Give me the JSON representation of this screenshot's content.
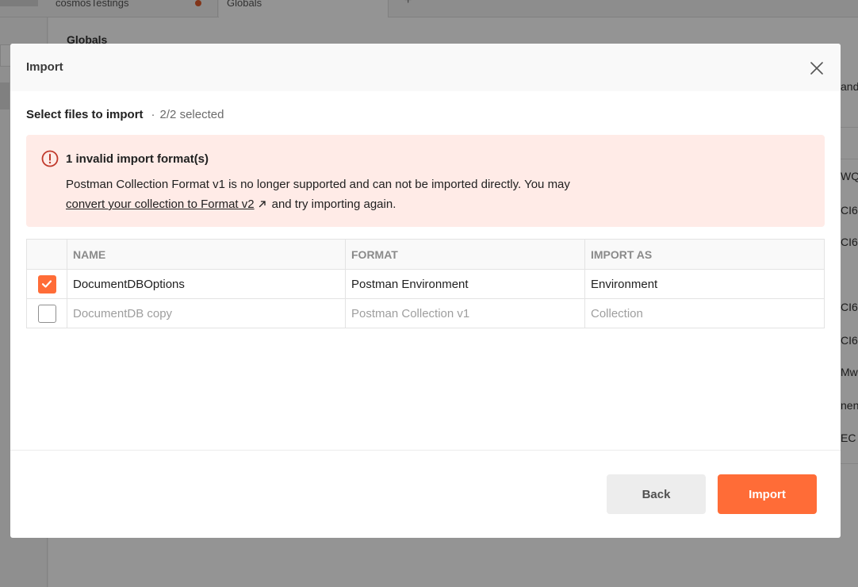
{
  "background": {
    "tabs": [
      {
        "label": "cosmosTestings"
      },
      {
        "label": "Globals"
      }
    ],
    "page_title": "Globals",
    "right_cells": [
      "and c",
      "WQ",
      "CI6",
      "CI6",
      "CI6",
      "CI6",
      "MwY",
      "nent",
      "EC"
    ]
  },
  "modal": {
    "title": "Import",
    "select_label": "Select files to import",
    "separator": "·",
    "selected_count": "2/2 selected",
    "alert": {
      "title": "1 invalid import format(s)",
      "message": "Postman Collection Format v1 is no longer supported and can not be imported directly. You may",
      "link_text": "convert your collection to Format v2",
      "message_end": "and try importing again."
    },
    "table": {
      "headers": [
        "NAME",
        "FORMAT",
        "IMPORT AS"
      ],
      "rows": [
        {
          "name": "DocumentDBOptions",
          "format": "Postman Environment",
          "import_as": "Environment",
          "checked": true
        },
        {
          "name": "DocumentDB copy",
          "format": "Postman Collection v1",
          "import_as": "Collection",
          "checked": false
        }
      ]
    },
    "buttons": {
      "back": "Back",
      "import": "Import"
    }
  },
  "colors": {
    "accent": "#ff6c37",
    "alert_bg": "#ffebe7",
    "error_icon": "#c0392b"
  }
}
